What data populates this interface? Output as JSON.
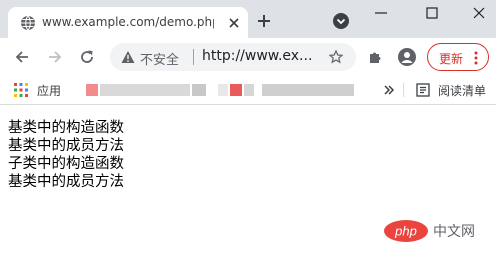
{
  "tab": {
    "title": "www.example.com/demo.php",
    "favicon": "globe-icon",
    "close_icon": "close-icon"
  },
  "window": {
    "new_tab_icon": "plus-icon",
    "tab_search_icon": "tab-search-icon",
    "minimize_icon": "minimize-icon",
    "maximize_icon": "maximize-icon",
    "close_window_icon": "close-window-icon"
  },
  "toolbar": {
    "back_icon": "back-arrow-icon",
    "forward_icon": "forward-arrow-icon",
    "reload_icon": "reload-icon",
    "security_label": "不安全",
    "url": "http://www.ex...",
    "bookmark_star_icon": "star-icon",
    "extensions_icon": "puzzle-icon",
    "profile_icon": "avatar-icon",
    "update_label": "更新",
    "menu_icon": "more-vert-icon"
  },
  "bookmarks": {
    "apps_label": "应用",
    "overflow_icon": "chevron-double-right-icon",
    "reading_list_label": "阅读清单"
  },
  "content": {
    "lines": [
      "基类中的构造函数",
      "基类中的成员方法",
      "子类中的构造函数",
      "基类中的成员方法"
    ]
  },
  "watermark": {
    "logo_text": "php",
    "text": "中文网"
  },
  "colors": {
    "tabstrip_bg": "#dee1e6",
    "accent_red": "#d93025",
    "omnibox_bg": "#f1f3f4"
  }
}
